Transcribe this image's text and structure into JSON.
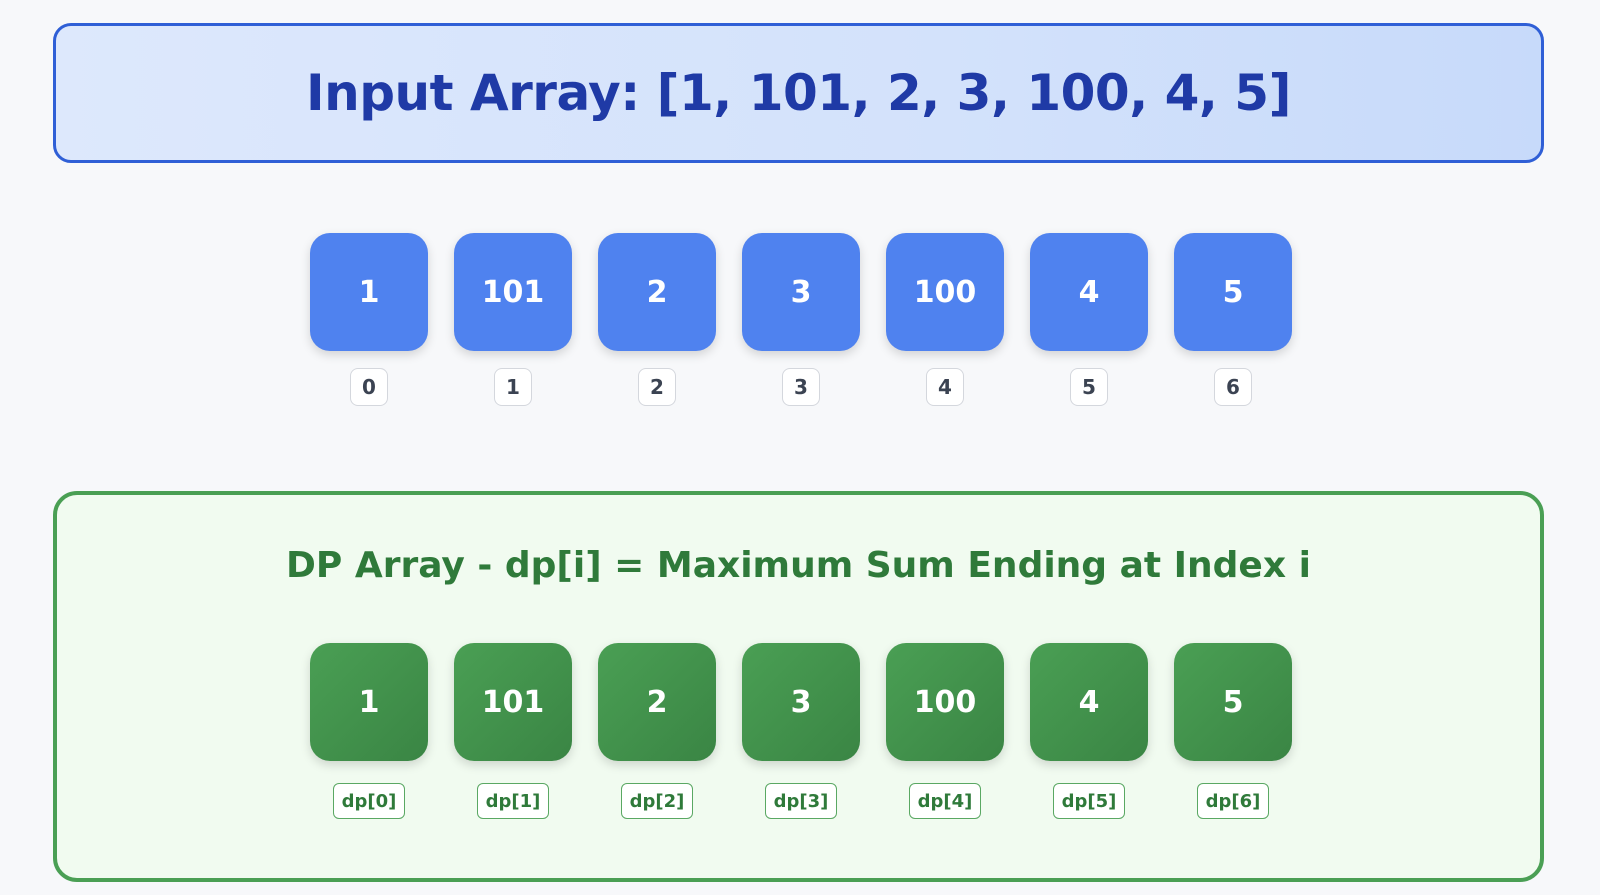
{
  "header": {
    "title": "Input Array: [1, 101, 2, 3, 100, 4, 5]"
  },
  "input_array": {
    "values": [
      "1",
      "101",
      "2",
      "3",
      "100",
      "4",
      "5"
    ],
    "indices": [
      "0",
      "1",
      "2",
      "3",
      "4",
      "5",
      "6"
    ]
  },
  "dp_section": {
    "title": "DP Array - dp[i] = Maximum Sum Ending at Index i",
    "values": [
      "1",
      "101",
      "2",
      "3",
      "100",
      "4",
      "5"
    ],
    "labels": [
      "dp[0]",
      "dp[1]",
      "dp[2]",
      "dp[3]",
      "dp[4]",
      "dp[5]",
      "dp[6]"
    ]
  },
  "colors": {
    "input_cell": "#4f82ef",
    "dp_cell": "#3a8544",
    "header_border": "#2f5fd6",
    "dp_border": "#4a9f54"
  }
}
